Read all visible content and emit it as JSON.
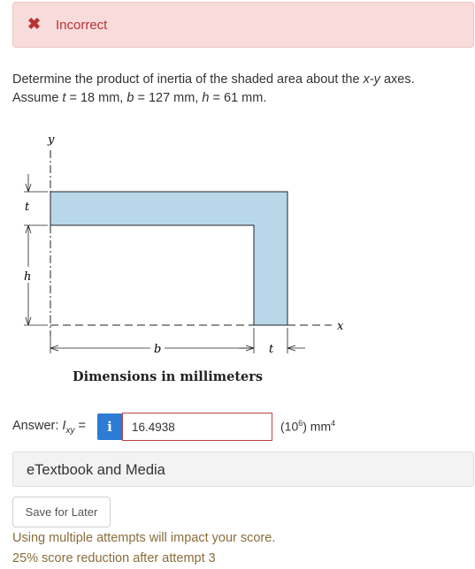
{
  "feedback": {
    "icon": "close-icon",
    "label": "Incorrect"
  },
  "question": {
    "p1": "Determine the product of inertia of the shaded area about the ",
    "axes_var": "x-y",
    "p2": " axes.",
    "assume": "Assume ",
    "t_var": "t",
    "t_val": " = 18 mm, ",
    "b_var": "b",
    "b_val": " = 127 mm, ",
    "h_var": "h",
    "h_val": " = 61 mm."
  },
  "figure": {
    "labels": {
      "y": "y",
      "x": "x",
      "t_left": "t",
      "h": "h",
      "b": "b",
      "t_bottom": "t"
    },
    "caption": "Dimensions in millimeters",
    "fill_color": "#b8d8ea"
  },
  "answer": {
    "label_prefix": "Answer: ",
    "var": "I",
    "sub": "xy",
    "eq": " = ",
    "info_icon": "i",
    "value": "16.4938",
    "unit_prefix": "(10",
    "unit_exp1": "6",
    "unit_mid": ") mm",
    "unit_exp2": "4"
  },
  "etextbook": {
    "label": "eTextbook and Media"
  },
  "save_button": {
    "label": "Save for Later"
  },
  "warning": {
    "line1": "Using multiple attempts will impact your score.",
    "line2": "25% score reduction after attempt 3"
  },
  "colors": {
    "alert_bg": "#f8dcdc",
    "alert_text": "#b83232",
    "info_button": "#2c7bd5",
    "warning_text": "#8a6d3b"
  }
}
